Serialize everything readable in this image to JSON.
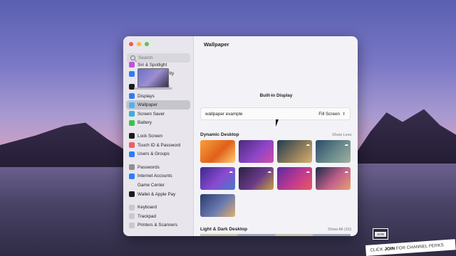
{
  "window": {
    "title": "Wallpaper"
  },
  "sidebar": {
    "search_placeholder": "Search",
    "groups": [
      [
        {
          "label": "Siri & Spotlight",
          "icon": "siri-icon",
          "color": "#c051e0"
        },
        {
          "label": "Privacy & Security",
          "icon": "hand-icon",
          "color": "#2f7cf6"
        }
      ],
      [
        {
          "label": "Desktop & Dock",
          "icon": "dock-icon",
          "color": "#1b1b1b"
        },
        {
          "label": "Displays",
          "icon": "displays-icon",
          "color": "#2f7cf6"
        },
        {
          "label": "Wallpaper",
          "icon": "wallpaper-icon",
          "color": "#48b4f0",
          "active": true
        },
        {
          "label": "Screen Saver",
          "icon": "screen-saver-icon",
          "color": "#3bb0d8"
        },
        {
          "label": "Battery",
          "icon": "battery-icon",
          "color": "#38c448"
        }
      ],
      [
        {
          "label": "Lock Screen",
          "icon": "lock-icon",
          "color": "#1b1b1b"
        },
        {
          "label": "Touch ID & Password",
          "icon": "fingerprint-icon",
          "color": "#ee5b6a"
        },
        {
          "label": "Users & Groups",
          "icon": "users-icon",
          "color": "#2f7cf6"
        }
      ],
      [
        {
          "label": "Passwords",
          "icon": "key-icon",
          "color": "#8e8e93"
        },
        {
          "label": "Internet Accounts",
          "icon": "at-icon",
          "color": "#2f7cf6"
        },
        {
          "label": "Game Center",
          "icon": "game-center-icon",
          "color": "#e8e8e8"
        },
        {
          "label": "Wallet & Apple Pay",
          "icon": "wallet-icon",
          "color": "#1b1b1b"
        }
      ],
      [
        {
          "label": "Keyboard",
          "icon": "keyboard-icon",
          "color": "#c8c8cc"
        },
        {
          "label": "Trackpad",
          "icon": "trackpad-icon",
          "color": "#c8c8cc"
        },
        {
          "label": "Printers & Scanners",
          "icon": "printer-icon",
          "color": "#c8c8cc"
        }
      ]
    ]
  },
  "main": {
    "display_label": "Built-in Display",
    "wallpaper_name": "wallpaper example",
    "fill_mode": "Fill Screen",
    "dynamic": {
      "title": "Dynamic Desktop",
      "link": "Show Less",
      "thumbs": [
        {
          "name": "ventura-orange",
          "colors": [
            "#f7a13a",
            "#e0601b",
            "#ffcf73"
          ]
        },
        {
          "name": "monterey-purple",
          "colors": [
            "#4a2a7a",
            "#8c45c8",
            "#d24ca8"
          ]
        },
        {
          "name": "big-sur-coast",
          "colors": [
            "#1f3a52",
            "#8a7a5a",
            "#d8b070"
          ],
          "download": true
        },
        {
          "name": "catalina-island",
          "colors": [
            "#2a4a6a",
            "#6a8a8a",
            "#a0b0a0"
          ],
          "download": true
        },
        {
          "name": "mojave-dusk",
          "colors": [
            "#3a2a8a",
            "#8a4ad0",
            "#4a7ac8"
          ],
          "download": true
        },
        {
          "name": "valley-dusk",
          "colors": [
            "#2a2040",
            "#6a3a8a",
            "#c8a040"
          ],
          "download": true
        },
        {
          "name": "monterey-violet",
          "colors": [
            "#5a2aa0",
            "#c03a90",
            "#e85a60"
          ],
          "download": true
        },
        {
          "name": "coast-evening",
          "colors": [
            "#1a2a4a",
            "#c0608a",
            "#e8a070"
          ],
          "download": true
        },
        {
          "name": "solar-gradient",
          "colors": [
            "#2a3a6a",
            "#6a7ab0",
            "#e0b070"
          ]
        }
      ]
    },
    "light_dark": {
      "title": "Light & Dark Desktop",
      "link": "Show All (16)"
    }
  },
  "overlay": {
    "join_badge": "JOIN",
    "banner_pre": "CLICK",
    "banner_join": "JOIN",
    "banner_post": "FOR CHANNEL PERKS"
  }
}
